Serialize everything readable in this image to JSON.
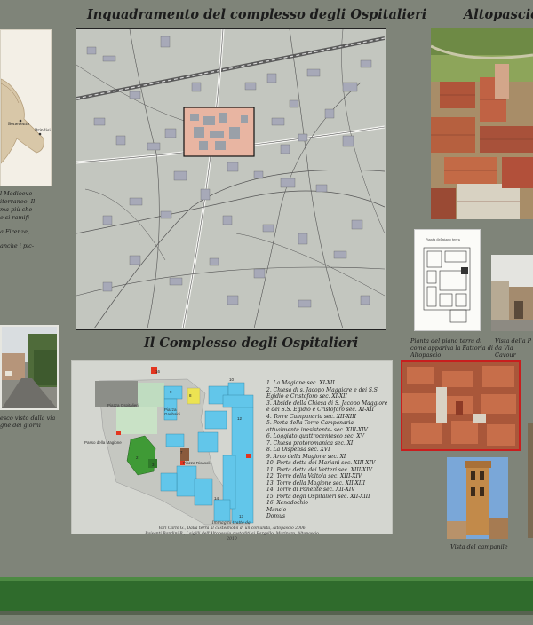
{
  "titles": {
    "map_title": "Inquadramento del complesso degli Ospitalieri",
    "site_title": "Altopascio",
    "complex_title": "Il Complesso degli Ospitalieri"
  },
  "europe_map_labels": [
    "Benevento",
    "Brindisi"
  ],
  "left_text_lines": [
    "l Medioevo",
    "iterraneo. Il",
    "ma più che",
    "e si ramifi-",
    "",
    "a Firenze,",
    "",
    "anche i pic-"
  ],
  "left_photo_caption": [
    "esco visto dalla via",
    "gne dei giorni"
  ],
  "plan_caption": [
    "Pianta del piano terra di",
    "come appariva la Fattoria di",
    "Altopascio"
  ],
  "vista_caption": [
    "Vista della P",
    "da Via Cavour"
  ],
  "campanile_caption": "Vista del campanile",
  "plan_labels": {
    "piazza_ospitalieri": "Piazza Ospitalieri",
    "piazza_garibaldi": "Piazza Garibaldi",
    "piazza_ricasoli": "Piazza Ricasoli",
    "passo_magione": "Passo della Magione"
  },
  "legend": [
    "1.  La Magione sec. XI-XII",
    "2.  Chiesa di s. Jacopo Maggiore e dei S.S. Egidio e Cristoforo sec. XI-XII",
    "3.  Abside della Chiesa di S. Jacopo Maggiore e dei S.S. Egidio e Cristoforo sec. XI-XII",
    "4.  Torre Campanaria sec. XII-XIII",
    "5.  Porta della Torre Campanaria - attualmente inesistente- sec. XIII-XIV",
    "6.  Loggiato quattrocentesco sec. XV",
    "7.  Chiesa protoromanica sec. XI",
    "8.  La Dispensa sec. XVI",
    "9.  Arco della Magione sec. XI",
    "10.  Porta detta dei Mariani sec. XIII-XIV",
    "11.  Porta detta dei Vetteri sec. XIII-XIV",
    "12.  Torre della Voltola sec. XIII-XIV",
    "13.  Torre della Magione sec. XII-XIII",
    "14.  Torre di Ponente sec. XII-XIV",
    "15.  Porta degli Ospitalieri sec. XII-XIII",
    "16.  Xenodochio",
    "       Mansio",
    "       Domus"
  ],
  "credits": [
    "Immagini tratte da:",
    "Vari Carlo G., Dalla terra al castelmobil di un comunita, Altopascio 2006",
    "Baisanti Bandini B., I sigilli dell'Altopascio custoditi ai Bargello, Murinaro, Altopascio 2010"
  ],
  "colors": {
    "background": "#7f8479",
    "panel": "#cfd3ca",
    "map_highlight": "#e8b5a2",
    "building_cyan": "#62c6ea",
    "building_green": "#3f9a36",
    "building_yellow": "#ece352",
    "building_brown": "#8a5a3c",
    "building_red": "#e3351f",
    "ground_green": "#2f6b2c"
  }
}
